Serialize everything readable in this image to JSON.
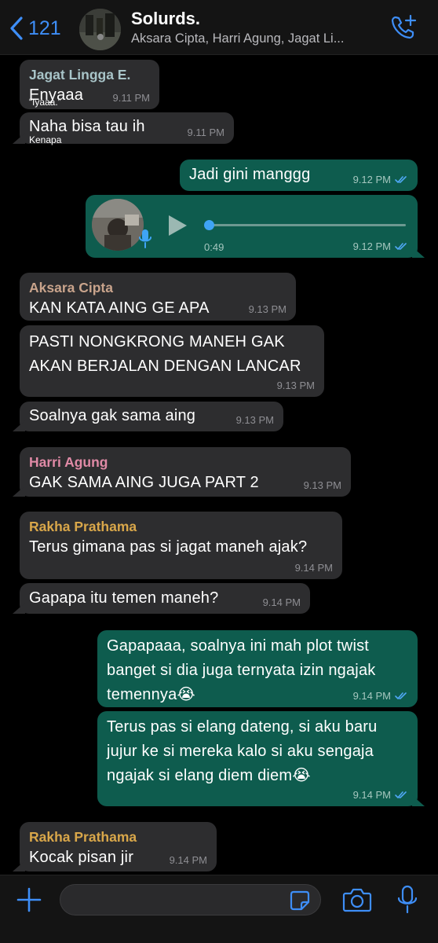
{
  "header": {
    "back_count": "121",
    "title": "Solurds.",
    "subtitle": "Aksara Cipta, Harri Agung, Jagat Li..."
  },
  "colors": {
    "accent": "#3e8ef7",
    "incoming_bubble": "#2d2d2f",
    "outgoing_bubble": "#0e5c4e",
    "sender_jagat": "#a8c4c8",
    "sender_aksara": "#c9a48c",
    "sender_harri": "#e08aa6",
    "sender_rakha": "#d9a74a",
    "read_ticks": "#4fa8f5"
  },
  "messages": [
    {
      "sender": "Jagat Lingga E.",
      "text": "Enyaaa",
      "time": "9.11 PM",
      "overlay": "“Iyaaa.”"
    },
    {
      "text": "Naha bisa tau ih",
      "time": "9.11 PM",
      "overlay": "Kenapa"
    },
    {
      "text": "Jadi gini manggg",
      "time": "9.12 PM"
    },
    {
      "voice_duration": "0:49",
      "time": "9.12 PM"
    },
    {
      "sender": "Aksara Cipta",
      "text": "KAN KATA AING GE APA",
      "time": "9.13 PM"
    },
    {
      "text_lines": [
        "PASTI NONGKRONG MANEH GAK",
        "AKAN BERJALAN DENGAN LANCAR"
      ],
      "time": "9.13 PM"
    },
    {
      "text": "Soalnya gak sama aing",
      "time": "9.13 PM"
    },
    {
      "sender": "Harri Agung",
      "text": "GAK SAMA AING JUGA PART 2",
      "time": "9.13 PM"
    },
    {
      "sender": "Rakha Prathama",
      "text": "Terus gimana pas si jagat maneh ajak?",
      "time": "9.14 PM"
    },
    {
      "text": "Gapapa itu temen maneh?",
      "time": "9.14 PM"
    },
    {
      "text_lines": [
        "Gapapaaa, soalnya ini mah plot twist",
        "banget si dia juga ternyata izin ngajak",
        "temennya😭"
      ],
      "time": "9.14 PM"
    },
    {
      "text_lines": [
        "Terus pas si elang dateng, si aku baru",
        "jujur ke si mereka kalo si aku sengaja",
        "ngajak si elang diem diem😭"
      ],
      "time": "9.14 PM"
    },
    {
      "sender": "Rakha Prathama",
      "text": "Kocak pisan jir",
      "time": "9.14 PM"
    }
  ],
  "input": {
    "value": ""
  }
}
